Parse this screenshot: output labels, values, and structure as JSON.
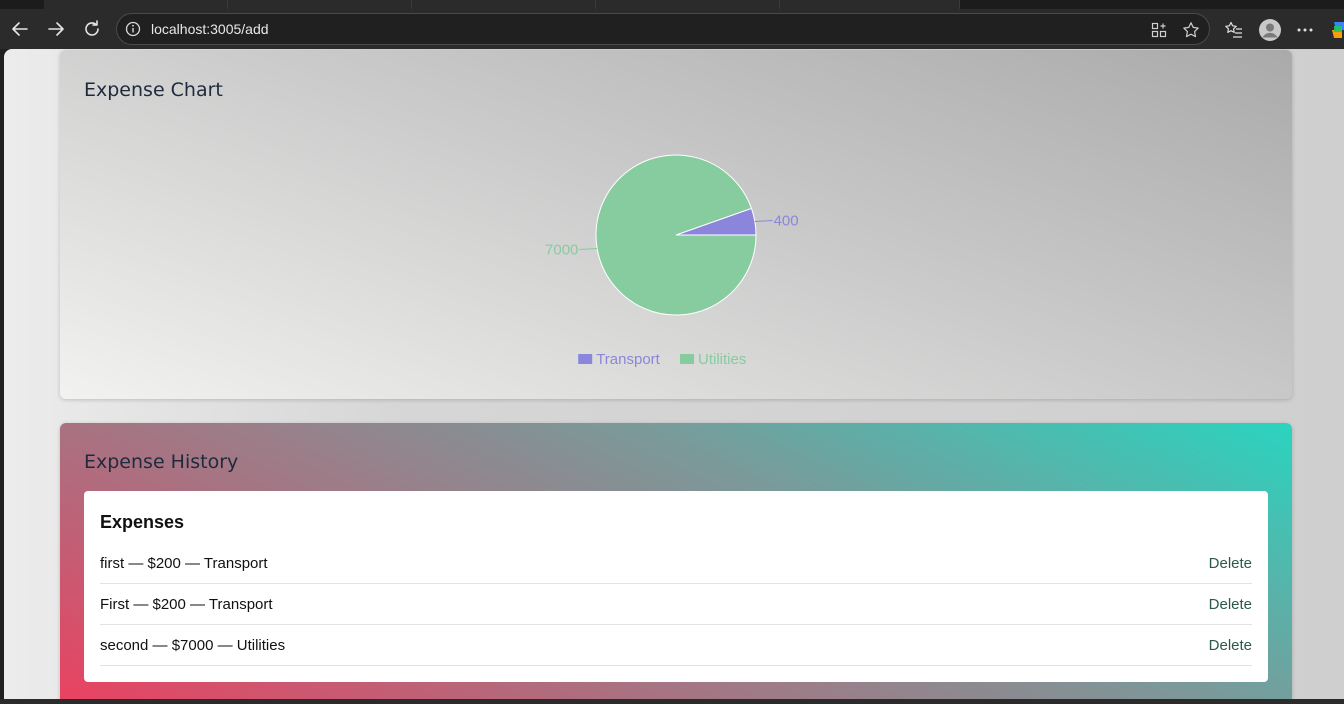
{
  "browser": {
    "url": "localhost:3005/add"
  },
  "chart_card": {
    "title": "Expense Chart"
  },
  "chart_data": {
    "type": "pie",
    "categories": [
      "Transport",
      "Utilities"
    ],
    "values": [
      400,
      7000
    ],
    "colors": [
      "#8b86db",
      "#86cc9f"
    ],
    "legend": "bottom",
    "labels_shown": [
      "400",
      "7000"
    ]
  },
  "history_card": {
    "title": "Expense History",
    "panel_title": "Expenses",
    "delete_label": "Delete",
    "items": [
      {
        "text": "first — $200 — Transport"
      },
      {
        "text": "First — $200 — Transport"
      },
      {
        "text": "second — $7000 — Utilities"
      }
    ]
  }
}
